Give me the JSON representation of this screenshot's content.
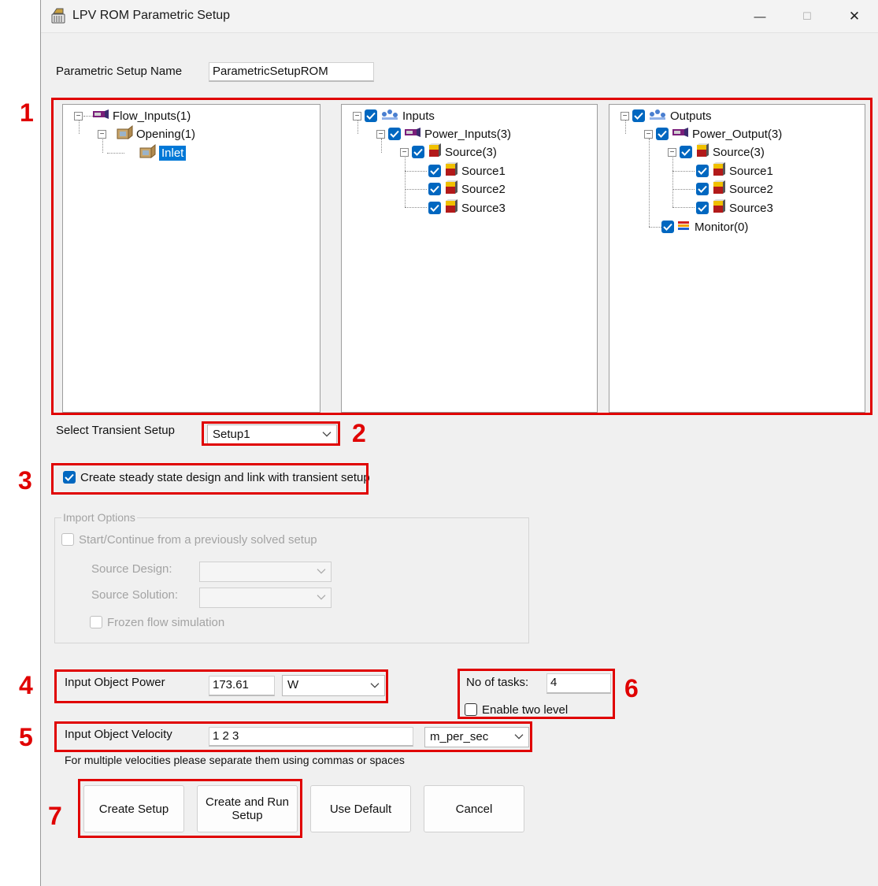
{
  "window": {
    "title": "LPV ROM Parametric Setup",
    "minimize_glyph": "—",
    "maximize_glyph": "☐",
    "close_glyph": "✕"
  },
  "setup_name": {
    "label": "Parametric Setup Name",
    "value": "ParametricSetupROM"
  },
  "trees": {
    "left": [
      {
        "label": "Flow_Inputs(1)",
        "icon": "component-icon"
      },
      {
        "label": "Opening(1)",
        "icon": "opening-icon"
      },
      {
        "label": "Inlet",
        "icon": "opening-icon",
        "selected": true
      }
    ],
    "middle": [
      {
        "label": "Inputs",
        "icon": "group-icon",
        "checked": true
      },
      {
        "label": "Power_Inputs(3)",
        "icon": "component-icon",
        "checked": true
      },
      {
        "label": "Source(3)",
        "icon": "source-icon",
        "checked": true
      },
      {
        "label": "Source1",
        "icon": "source-icon",
        "checked": true
      },
      {
        "label": "Source2",
        "icon": "source-icon",
        "checked": true
      },
      {
        "label": "Source3",
        "icon": "source-icon",
        "checked": true
      }
    ],
    "right": [
      {
        "label": "Outputs",
        "icon": "group-icon",
        "checked": true
      },
      {
        "label": "Power_Output(3)",
        "icon": "component-icon",
        "checked": true
      },
      {
        "label": "Source(3)",
        "icon": "source-icon",
        "checked": true
      },
      {
        "label": "Source1",
        "icon": "source-icon",
        "checked": true
      },
      {
        "label": "Source2",
        "icon": "source-icon",
        "checked": true
      },
      {
        "label": "Source3",
        "icon": "source-icon",
        "checked": true
      },
      {
        "label": "Monitor(0)",
        "icon": "monitor-icon",
        "checked": true
      }
    ]
  },
  "transient": {
    "label": "Select Transient Setup",
    "value": "Setup1"
  },
  "steady_state": {
    "label": "Create steady state design and link with transient setup",
    "checked": true
  },
  "import_options": {
    "title": "Import Options",
    "start_continue": {
      "label": "Start/Continue from a previously solved setup",
      "checked": false
    },
    "source_design_label": "Source Design:",
    "source_solution_label": "Source Solution:",
    "frozen_flow": {
      "label": "Frozen flow simulation",
      "checked": false
    }
  },
  "power": {
    "label": "Input Object Power",
    "value": "173.61",
    "unit": "W"
  },
  "velocity": {
    "label": "Input Object Velocity",
    "value": "1 2 3",
    "unit": "m_per_sec",
    "hint": "For multiple velocities please separate them using commas or spaces"
  },
  "tasks": {
    "label": "No of tasks:",
    "value": "4",
    "two_level_label": "Enable two level",
    "two_level_checked": false
  },
  "buttons": {
    "create_setup": "Create Setup",
    "create_run_line1": "Create and Run",
    "create_run_line2": "Setup",
    "use_default": "Use Default",
    "cancel": "Cancel"
  },
  "annotations": [
    "1",
    "2",
    "3",
    "4",
    "5",
    "6",
    "7"
  ],
  "colors": {
    "highlight": "#e00000",
    "checkbox": "#0067c0",
    "selection": "#0078d7"
  }
}
